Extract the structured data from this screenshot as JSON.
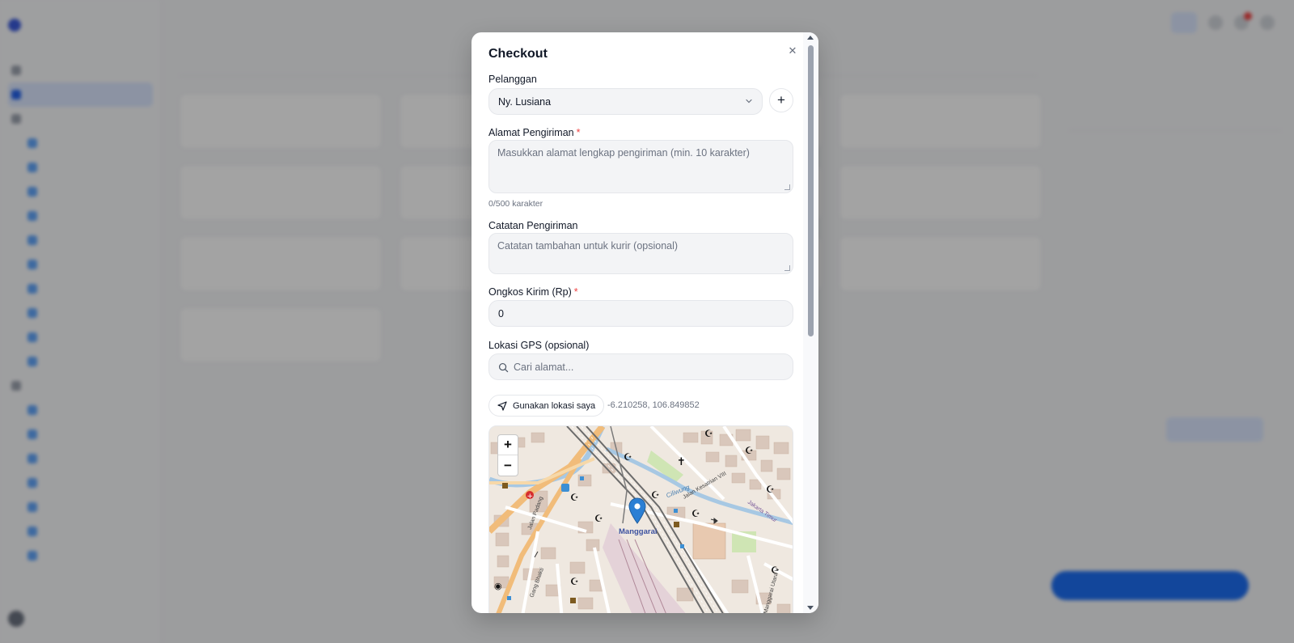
{
  "modal": {
    "title": "Checkout",
    "customer": {
      "label": "Pelanggan",
      "selected": "Ny. Lusiana",
      "add_icon": "plus-icon"
    },
    "address": {
      "label": "Alamat Pengiriman",
      "required_mark": "*",
      "placeholder": "Masukkan alamat lengkap pengiriman (min. 10 karakter)",
      "counter": "0/500 karakter"
    },
    "notes": {
      "label": "Catatan Pengiriman",
      "placeholder": "Catatan tambahan untuk kurir (opsional)"
    },
    "shipping_cost": {
      "label": "Ongkos Kirim (Rp)",
      "required_mark": "*",
      "value": "0"
    },
    "gps": {
      "label": "Lokasi GPS (opsional)",
      "search_placeholder": "Cari alamat...",
      "use_location_label": "Gunakan lokasi saya",
      "coordinates": "-6.210258, 106.849852"
    },
    "map": {
      "zoom_in": "+",
      "zoom_out": "−",
      "marker_label": "Manggarai",
      "street_labels": [
        "Jalan Kesatrian VIII",
        "Ciliwung",
        "Jalan Padang",
        "Gang Bhakti",
        "Manggarai Utara V",
        "Jakarta Timur"
      ]
    }
  },
  "colors": {
    "accent": "#2563eb",
    "required": "#ef4444",
    "marker": "#2b7fd4"
  }
}
